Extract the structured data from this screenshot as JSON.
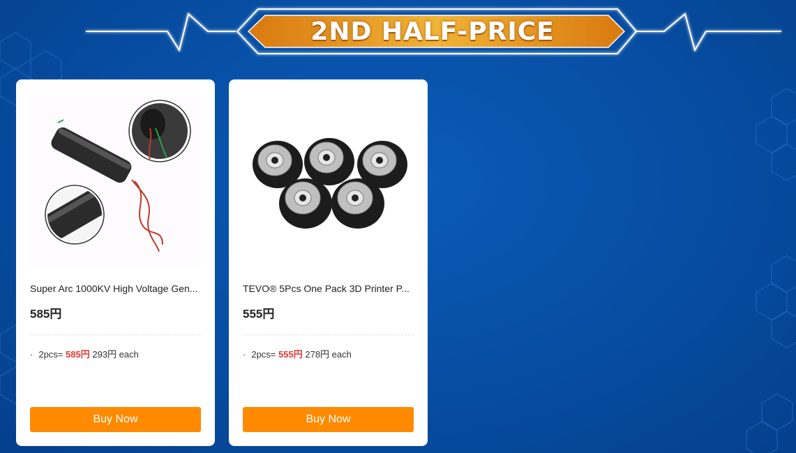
{
  "banner": {
    "title": "2ND HALF-PRICE"
  },
  "products": [
    {
      "title": "Super Arc 1000KV High Voltage Gen...",
      "price": "585円",
      "deal_prefix": "2pcs=",
      "deal_total": "585円",
      "deal_each": "293円 each",
      "buy_label": "Buy Now"
    },
    {
      "title": "TEVO® 5Pcs One Pack 3D Printer P...",
      "price": "555円",
      "deal_prefix": "2pcs=",
      "deal_total": "555円",
      "deal_each": "278円 each",
      "buy_label": "Buy Now"
    }
  ],
  "colors": {
    "background": "#0750a6",
    "banner_orange": "#e8901c",
    "button_orange": "#ff8a00",
    "deal_red": "#e53935"
  },
  "icons": [
    "high-voltage-generator-image",
    "pulley-wheels-image",
    "hexagon-pattern"
  ]
}
